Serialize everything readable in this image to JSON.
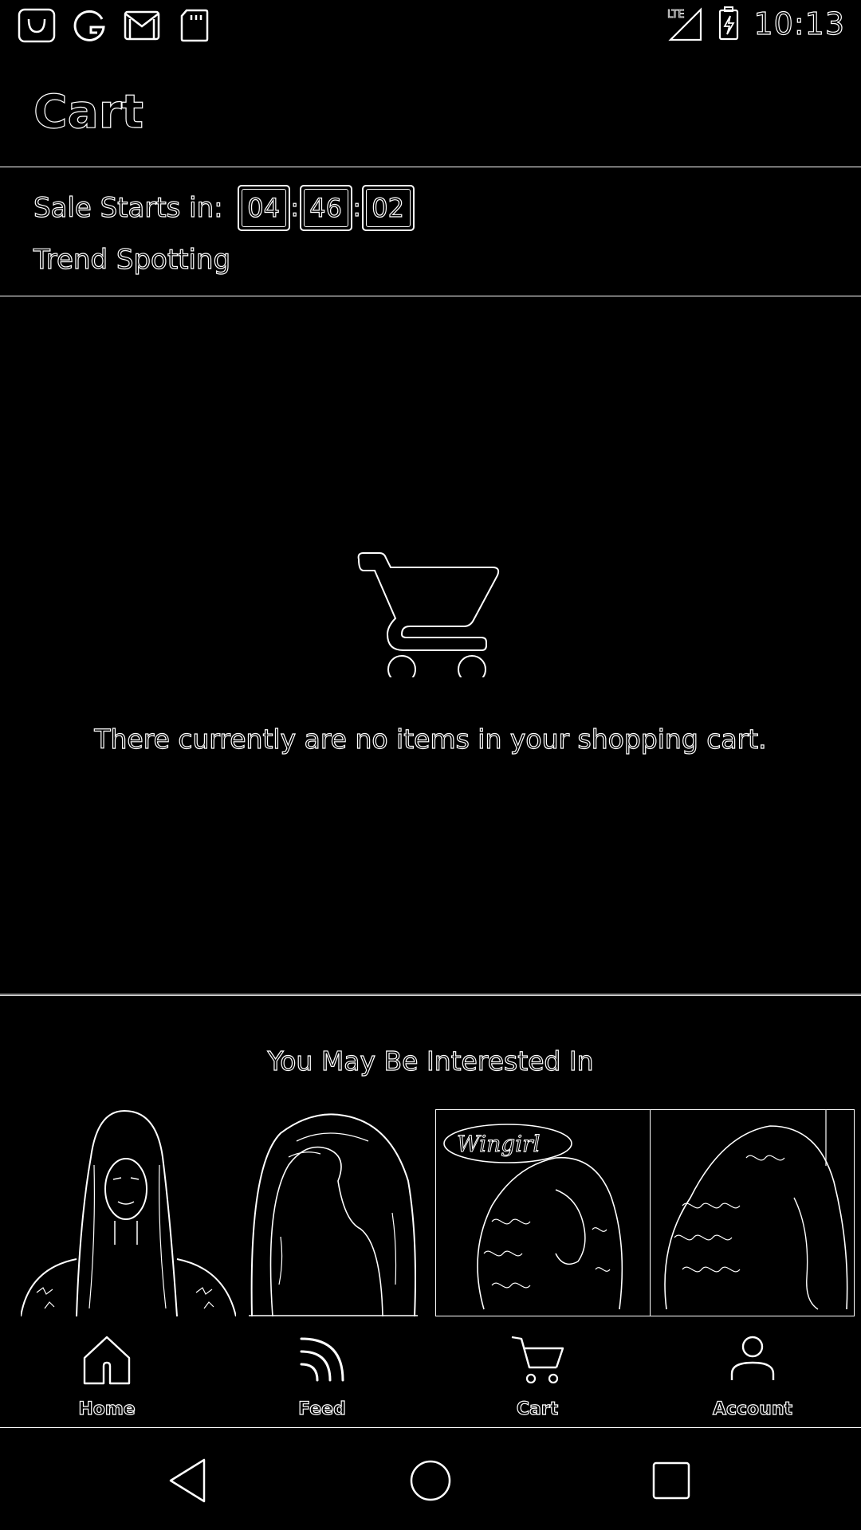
{
  "status_bar": {
    "time": "10:13",
    "network": "LTE",
    "left_icons": [
      "shopping-bag-icon",
      "google-icon",
      "gmail-icon",
      "sd-card-icon"
    ]
  },
  "header": {
    "title": "Cart"
  },
  "sale": {
    "label": "Sale Starts in:",
    "hours": "04",
    "minutes": "46",
    "seconds": "02",
    "separator": ":",
    "subtitle": "Trend Spotting"
  },
  "empty_cart": {
    "icon": "shopping-cart-icon",
    "message": "There currently are no items in your shopping cart."
  },
  "recommendations": {
    "title": "You May Be Interested In",
    "products": [
      {
        "name": "wig-product-1"
      },
      {
        "name": "wig-product-2"
      },
      {
        "name": "wig-product-3"
      },
      {
        "name": "wig-product-4"
      }
    ],
    "product_3_logo_text": "Wingirl"
  },
  "bottom_nav": {
    "items": [
      {
        "label": "Home",
        "icon": "home-icon"
      },
      {
        "label": "Feed",
        "icon": "feed-icon"
      },
      {
        "label": "Cart",
        "icon": "cart-icon"
      },
      {
        "label": "Account",
        "icon": "account-icon"
      }
    ],
    "active": "Cart"
  },
  "system_nav": {
    "buttons": [
      "back-icon",
      "home-circle-icon",
      "recents-icon"
    ]
  }
}
